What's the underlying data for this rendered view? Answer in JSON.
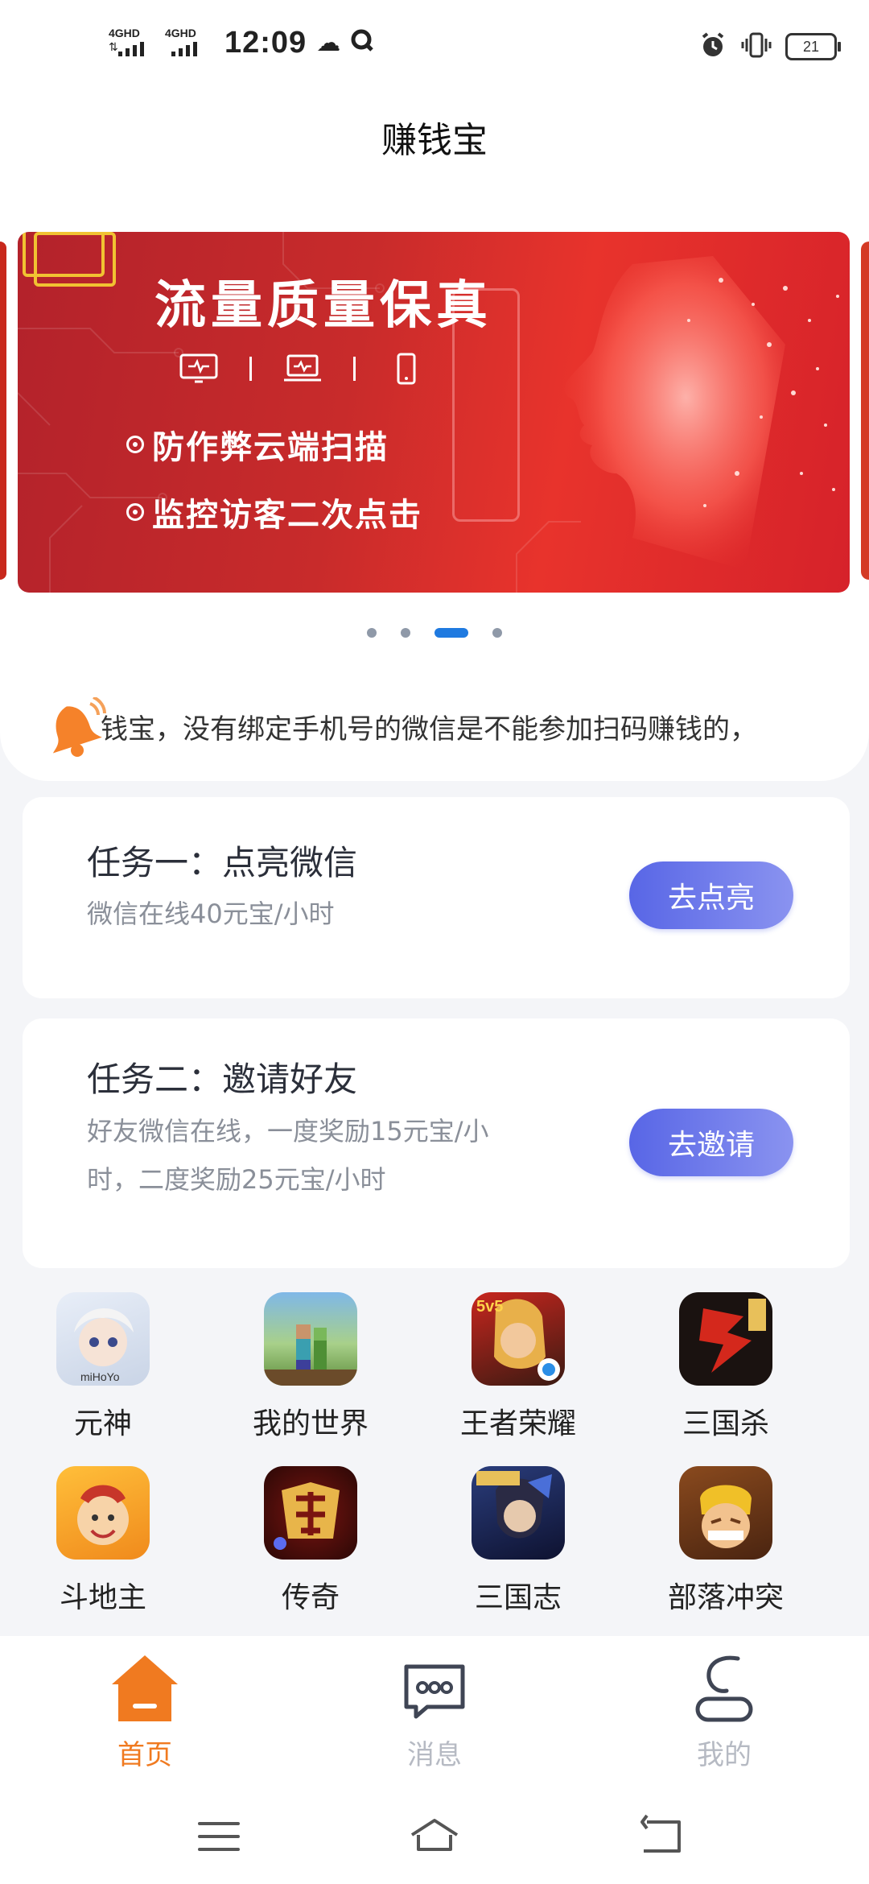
{
  "status_bar": {
    "network1": "4GHD",
    "network2": "4GHD",
    "time": "12:09",
    "battery": "21"
  },
  "header": {
    "title": "赚钱宝"
  },
  "banner": {
    "headline": "流量质量保真",
    "bullets": [
      "防作弊云端扫描",
      "监控访客二次点击"
    ],
    "active_dot": 2,
    "dot_count": 4
  },
  "notice": {
    "text": "钱宝，没有绑定手机号的微信是不能参加扫码赚钱的，"
  },
  "tasks": [
    {
      "title": "任务一：点亮微信",
      "desc": "微信在线40元宝/小时",
      "button": "去点亮"
    },
    {
      "title": "任务二：邀请好友",
      "desc": "好友微信在线，一度奖励15元宝/小时，二度奖励25元宝/小时",
      "button": "去邀请"
    }
  ],
  "games": [
    {
      "label": "元神",
      "icon": "genshin-icon"
    },
    {
      "label": "我的世界",
      "icon": "minecraft-icon"
    },
    {
      "label": "王者荣耀",
      "icon": "honor-of-kings-icon"
    },
    {
      "label": "三国杀",
      "icon": "sanguosha-icon"
    },
    {
      "label": "斗地主",
      "icon": "doudizhu-icon"
    },
    {
      "label": "传奇",
      "icon": "chuanqi-icon"
    },
    {
      "label": "三国志",
      "icon": "sanguozhi-icon"
    },
    {
      "label": "部落冲突",
      "icon": "clash-of-clans-icon"
    }
  ],
  "bottom_nav": [
    {
      "label": "首页",
      "icon": "home-icon",
      "active": true
    },
    {
      "label": "消息",
      "icon": "message-icon",
      "active": false
    },
    {
      "label": "我的",
      "icon": "profile-icon",
      "active": false
    }
  ],
  "colors": {
    "accent": "#f07a20",
    "button_gradient_start": "#5866e6",
    "button_gradient_end": "#8a93f0",
    "dot_active": "#1f7ae0",
    "banner_red": "#c82b2b"
  }
}
